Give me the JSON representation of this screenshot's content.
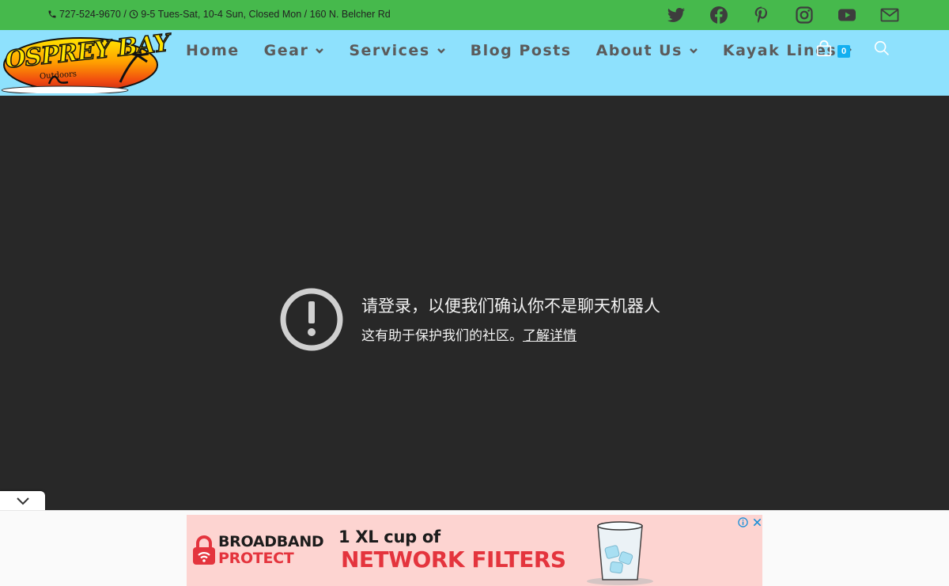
{
  "topbar": {
    "phone": "727-524-9670",
    "separator": " / ",
    "hours": "9-5 Tues-Sat, 10-4 Sun, Closed Mon",
    "address": " / 160 N. Belcher Rd",
    "social_icons": [
      "twitter-icon",
      "facebook-icon",
      "pinterest-icon",
      "instagram-icon",
      "youtube-icon",
      "mail-icon"
    ]
  },
  "logo": {
    "title": "OSPREY BAY",
    "subtitle": "Outdoors"
  },
  "nav": {
    "items": [
      {
        "label": "Home",
        "has_dropdown": false
      },
      {
        "label": "Gear",
        "has_dropdown": true
      },
      {
        "label": "Services",
        "has_dropdown": true
      },
      {
        "label": "Blog Posts",
        "has_dropdown": false
      },
      {
        "label": "About Us",
        "has_dropdown": true
      },
      {
        "label": "Kayak Lines",
        "has_dropdown": true
      }
    ],
    "cart_count": "0"
  },
  "notice": {
    "title": "请登录，以便我们确认你不是聊天机器人",
    "subtitle": "这有助于保护我们的社区。",
    "link": "了解详情"
  },
  "ad": {
    "brand_line1": "BROADBAND",
    "brand_line2": "PROTECT",
    "headline_line1": "1 XL cup of",
    "headline_line2": "NETWORK FILTERS"
  },
  "colors": {
    "topbar_bg": "#46b94c",
    "header_bg": "#8ee1fd",
    "main_bg": "#282828",
    "cart_badge": "#13aff0",
    "ad_bg": "#fdd4d1",
    "ad_red": "#e4343d"
  }
}
